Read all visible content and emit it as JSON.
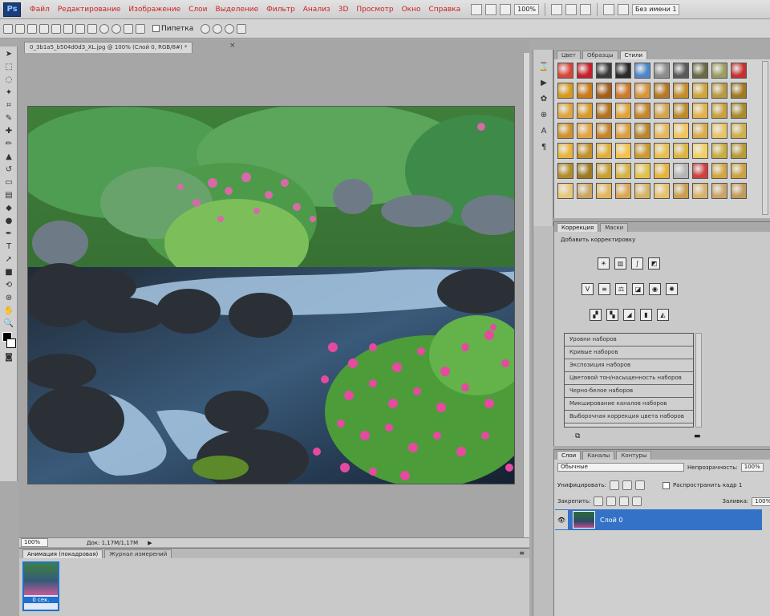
{
  "app": {
    "logo": "Ps"
  },
  "menubar": {
    "items": [
      "Файл",
      "Редактирование",
      "Изображение",
      "Слои",
      "Выделение",
      "Фильтр",
      "Анализ",
      "3D",
      "Просмотр",
      "Окно",
      "Справка"
    ],
    "zoom": "100%",
    "workspace": "Без имени 1"
  },
  "options": {
    "antialias_label": "Пипетка"
  },
  "document": {
    "tab_title": "0_3b1a5_b504d0d3_XL.jpg @ 100% (Слой 0, RGB/8#) *",
    "zoom": "100%",
    "doc_info": "Док: 1,17M/1,17M"
  },
  "animation": {
    "tabs": [
      "Анимация (покадровая)",
      "Журнал измерений"
    ],
    "frame_delay": "0 сек."
  },
  "swatches_panel": {
    "tabs": [
      "Цвет",
      "Образцы",
      "Стили"
    ],
    "style_colors": [
      "#d8463a",
      "#c5202b",
      "#3a3a3a",
      "#2a2a2a",
      "#4c88c9",
      "#8c8c8c",
      "#5a5a5a",
      "#6a6a46",
      "#9c9c62",
      "#c83030",
      "#d79a1d",
      "#c97a1a",
      "#a65e16",
      "#cf7a2a",
      "#d8953c",
      "#b87820",
      "#c58d2a",
      "#d0a43a",
      "#b99a40",
      "#a07a20",
      "#e0a440",
      "#d99a2c",
      "#b4731e",
      "#e0a33a",
      "#c7862a",
      "#d4a44a",
      "#bd8a2e",
      "#e2b34a",
      "#caa03c",
      "#aa8b2c",
      "#d1922c",
      "#e3a444",
      "#c68427",
      "#dc9e3c",
      "#b9862c",
      "#e6b75a",
      "#f0c45a",
      "#d9ac4a",
      "#e8c466",
      "#ceb04e",
      "#e9b43c",
      "#c3902a",
      "#e3ae38",
      "#f2c24a",
      "#cd9a2e",
      "#e7c04e",
      "#dbb444",
      "#f0d060",
      "#c9ad3e",
      "#b89a36",
      "#b38d2a",
      "#9e7a22",
      "#c8a032",
      "#d6b242",
      "#e2c24c",
      "#e7b43a",
      "#b5b5b5",
      "#d04040",
      "#d3a644",
      "#caa244",
      "#e7c77a",
      "#caa662",
      "#e2b65a",
      "#dba654",
      "#d6b466",
      "#e6c06a",
      "#c99e4e",
      "#d8b26a",
      "#caa468",
      "#c29a5a"
    ]
  },
  "adjustments": {
    "tabs": [
      "Коррекция",
      "Маски"
    ],
    "header": "Добавить корректировку",
    "presets": [
      "Уровни наборов",
      "Кривые наборов",
      "Экспозиция наборов",
      "Цветовой тон/насыщенность наборов",
      "Черно-белое наборов",
      "Микширование каналов наборов",
      "Выборочная коррекция цвета наборов"
    ]
  },
  "layers": {
    "tabs": [
      "Слои",
      "Каналы",
      "Контуры"
    ],
    "blend_mode": "Обычные",
    "opacity_label": "Непрозрачность:",
    "opacity": "100%",
    "unify_label": "Унифицировать:",
    "propagate_label": "Распространить кадр 1",
    "lock_label": "Закрепить:",
    "fill_label": "Заливка:",
    "fill": "100%",
    "layer_name": "Слой 0"
  }
}
